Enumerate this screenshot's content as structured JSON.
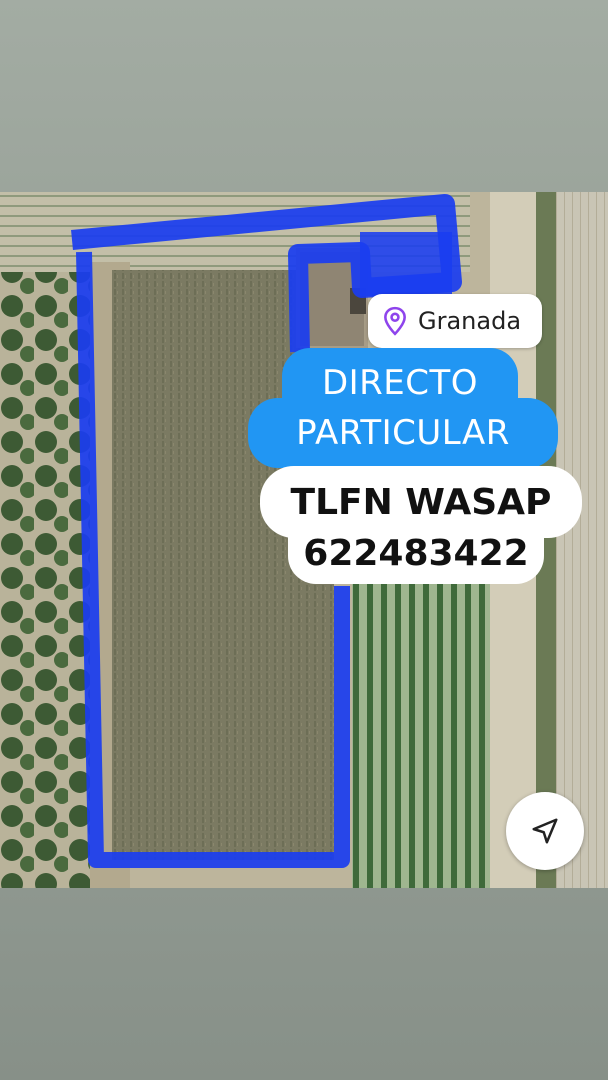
{
  "location_sticker": {
    "icon": "map-pin-icon",
    "label": "Granada",
    "icon_color": "#8e44ec"
  },
  "headline": {
    "line1": "DIRECTO",
    "line2": "PARTICULAR",
    "background": "#2196f3"
  },
  "contact": {
    "line1": "TLFN WASAP",
    "line2": "622483422"
  },
  "nav_button": {
    "icon": "navigation-arrow-icon"
  },
  "plot_outline_color": "#1a3df0"
}
